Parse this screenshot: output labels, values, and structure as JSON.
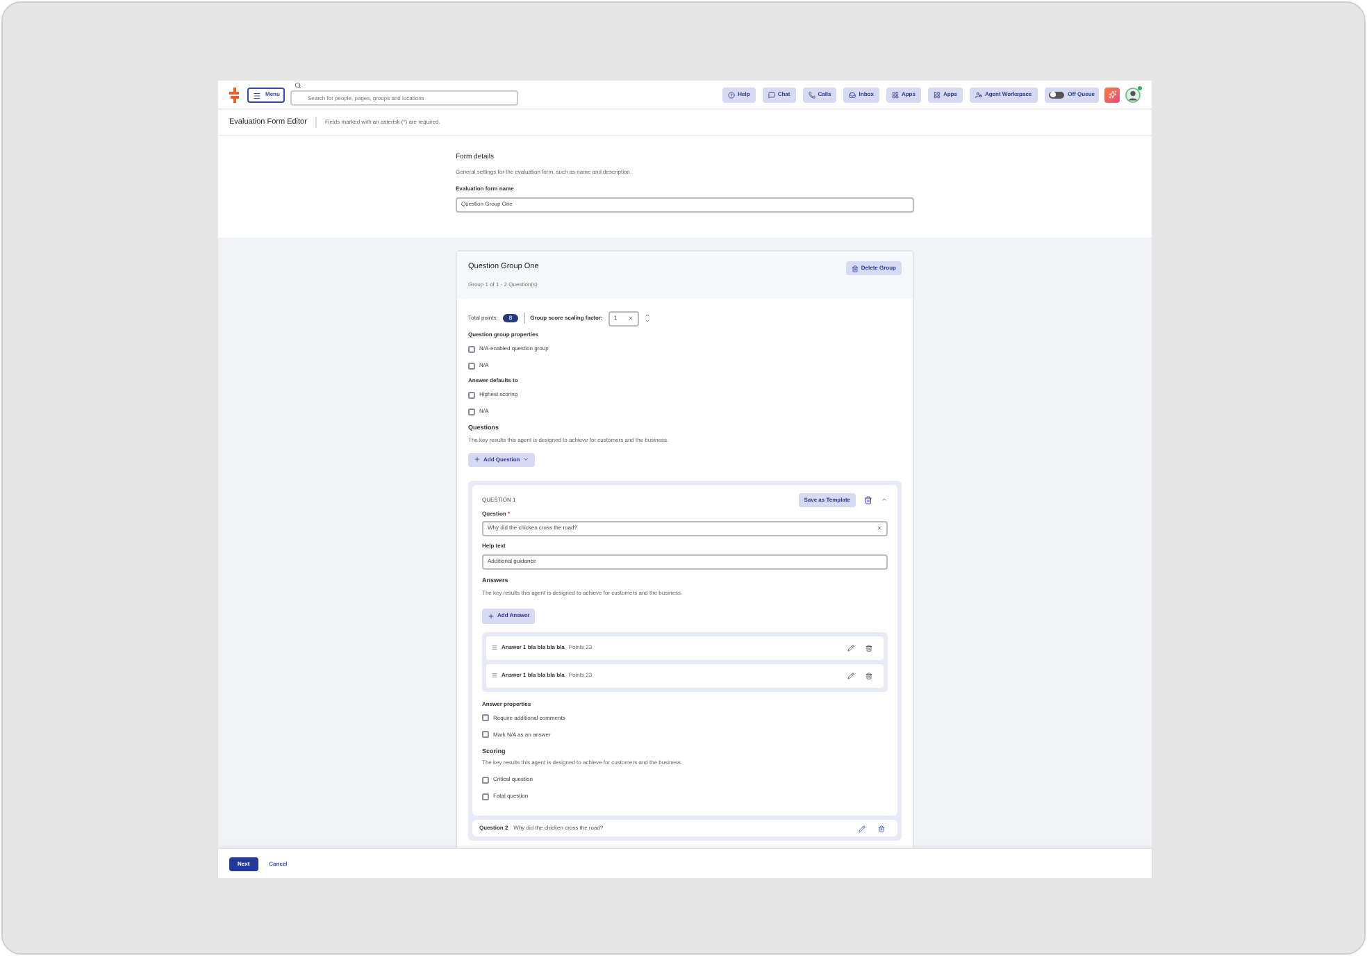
{
  "topbar": {
    "menu_button": "Menu",
    "search": {
      "placeholder": "Search for people, pages, groups and locations"
    },
    "buttons": [
      {
        "kind": "help",
        "label": "Help"
      },
      {
        "kind": "chat",
        "label": "Chat"
      },
      {
        "kind": "calls",
        "label": "Calls"
      },
      {
        "kind": "inbox",
        "label": "Inbox"
      },
      {
        "kind": "apps",
        "label": "Apps"
      },
      {
        "kind": "apps",
        "label": "Apps"
      },
      {
        "kind": "agent",
        "label": "Agent Workspace"
      }
    ],
    "queue_toggle": {
      "label": "Off Queue",
      "on": false
    },
    "avatar": {
      "online": true
    }
  },
  "header": {
    "title": "Evaluation Form Editor",
    "note": "Fields marked with an asterisk (*) are required."
  },
  "form_details": {
    "title": "Form details",
    "description": "General settings for the evaluation form, such as name and description.",
    "name_label": "Evaluation form name",
    "name_value": "Question Group One"
  },
  "group": {
    "title": "Question Group One",
    "subtitle": "Group 1 of 1 - 2 Question(s)",
    "delete_button": "Delete Group",
    "total_points_label": "Total points:",
    "total_points": "8",
    "scaling_label": "Group score scaling factor:",
    "scaling_value": "1",
    "properties_title": "Question group properties",
    "properties": [
      {
        "label": "N/A-enabled question group",
        "checked": false
      },
      {
        "label": "N/A",
        "checked": false
      }
    ],
    "defaults_title": "Answer defaults to",
    "defaults": [
      {
        "label": "Highest scoring",
        "checked": false
      },
      {
        "label": "N/A",
        "checked": false
      }
    ],
    "questions_title": "Questions",
    "questions_description": "The key results this agent is designed to achieve for customers and the business.",
    "add_question_button": "Add Question"
  },
  "question": {
    "heading": "QUESTION 1",
    "save_template_button": "Save as Template",
    "expanded": true,
    "question_label": "Question",
    "required_mark": "*",
    "question_value": "Why did the chicken cross the road?",
    "help_label": "Help text",
    "help_value": "Additional guidance",
    "answers_title": "Answers",
    "answers_description": "The key results this agent is designed to achieve for customers and the business.",
    "add_answer_button": "Add Answer",
    "answers": [
      {
        "text": "Answer 1 bla bla bla bla",
        "points": "Points 23"
      },
      {
        "text": "Answer 1 bla bla bla bla",
        "points": "Points 23"
      }
    ],
    "answer_properties_title": "Answer properties",
    "answer_properties": [
      {
        "label": "Require additional comments",
        "checked": false
      },
      {
        "label": "Mark N/A as an answer",
        "checked": false
      }
    ],
    "scoring_title": "Scoring",
    "scoring_description": "The key results this agent is designed to achieve for customers and the business.",
    "scoring": [
      {
        "label": "Critical question",
        "checked": false
      },
      {
        "label": "Fatal question",
        "checked": false
      }
    ]
  },
  "question_2": {
    "heading": "Question 2",
    "text": "Why did the chicken cross the road?"
  },
  "footer": {
    "next_button": "Next",
    "cancel_button": "Cancel"
  }
}
